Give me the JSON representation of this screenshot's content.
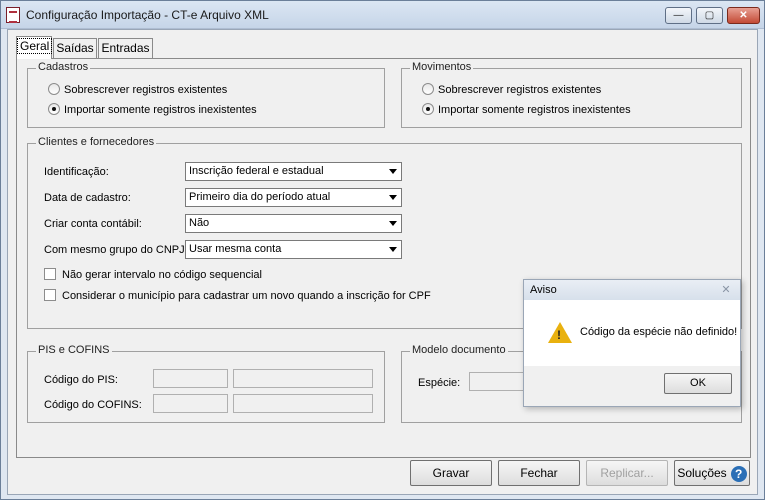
{
  "window": {
    "title": "Configuração Importação - CT-e Arquivo XML",
    "min_label": "—",
    "max_label": "▢",
    "close_label": "✕"
  },
  "tabs": [
    {
      "label": "Geral",
      "active": true
    },
    {
      "label": "Saídas",
      "active": false
    },
    {
      "label": "Entradas",
      "active": false
    }
  ],
  "cadastros": {
    "title": "Cadastros",
    "options": [
      "Sobrescrever registros existentes",
      "Importar somente registros inexistentes"
    ],
    "selected": 1
  },
  "movimentos": {
    "title": "Movimentos",
    "options": [
      "Sobrescrever registros existentes",
      "Importar somente registros inexistentes"
    ],
    "selected": 1
  },
  "clientes": {
    "title": "Clientes e fornecedores",
    "fields": [
      {
        "label": "Identificação:",
        "value": "Inscrição federal e estadual"
      },
      {
        "label": "Data de cadastro:",
        "value": "Primeiro dia do período atual"
      },
      {
        "label": "Criar conta contábil:",
        "value": "Não"
      },
      {
        "label": "Com mesmo grupo do CNPJ:",
        "value": "Usar mesma conta"
      }
    ],
    "checks": [
      {
        "label": "Não gerar intervalo no código sequencial",
        "checked": false
      },
      {
        "label": "Considerar o município para cadastrar um novo quando a inscrição for CPF",
        "checked": false
      }
    ]
  },
  "pis_cofins": {
    "title": "PIS e COFINS",
    "pis_label": "Código do PIS:",
    "cofins_label": "Código do COFINS:"
  },
  "modelo": {
    "title": "Modelo documento",
    "especie_label": "Espécie:"
  },
  "buttons": {
    "gravar": "Gravar",
    "fechar": "Fechar",
    "replicar": "Replicar...",
    "solucoes": "Soluções",
    "help": "?"
  },
  "dialog": {
    "title": "Aviso",
    "message": "Código da espécie não definido!",
    "ok": "OK",
    "close": "✕"
  }
}
